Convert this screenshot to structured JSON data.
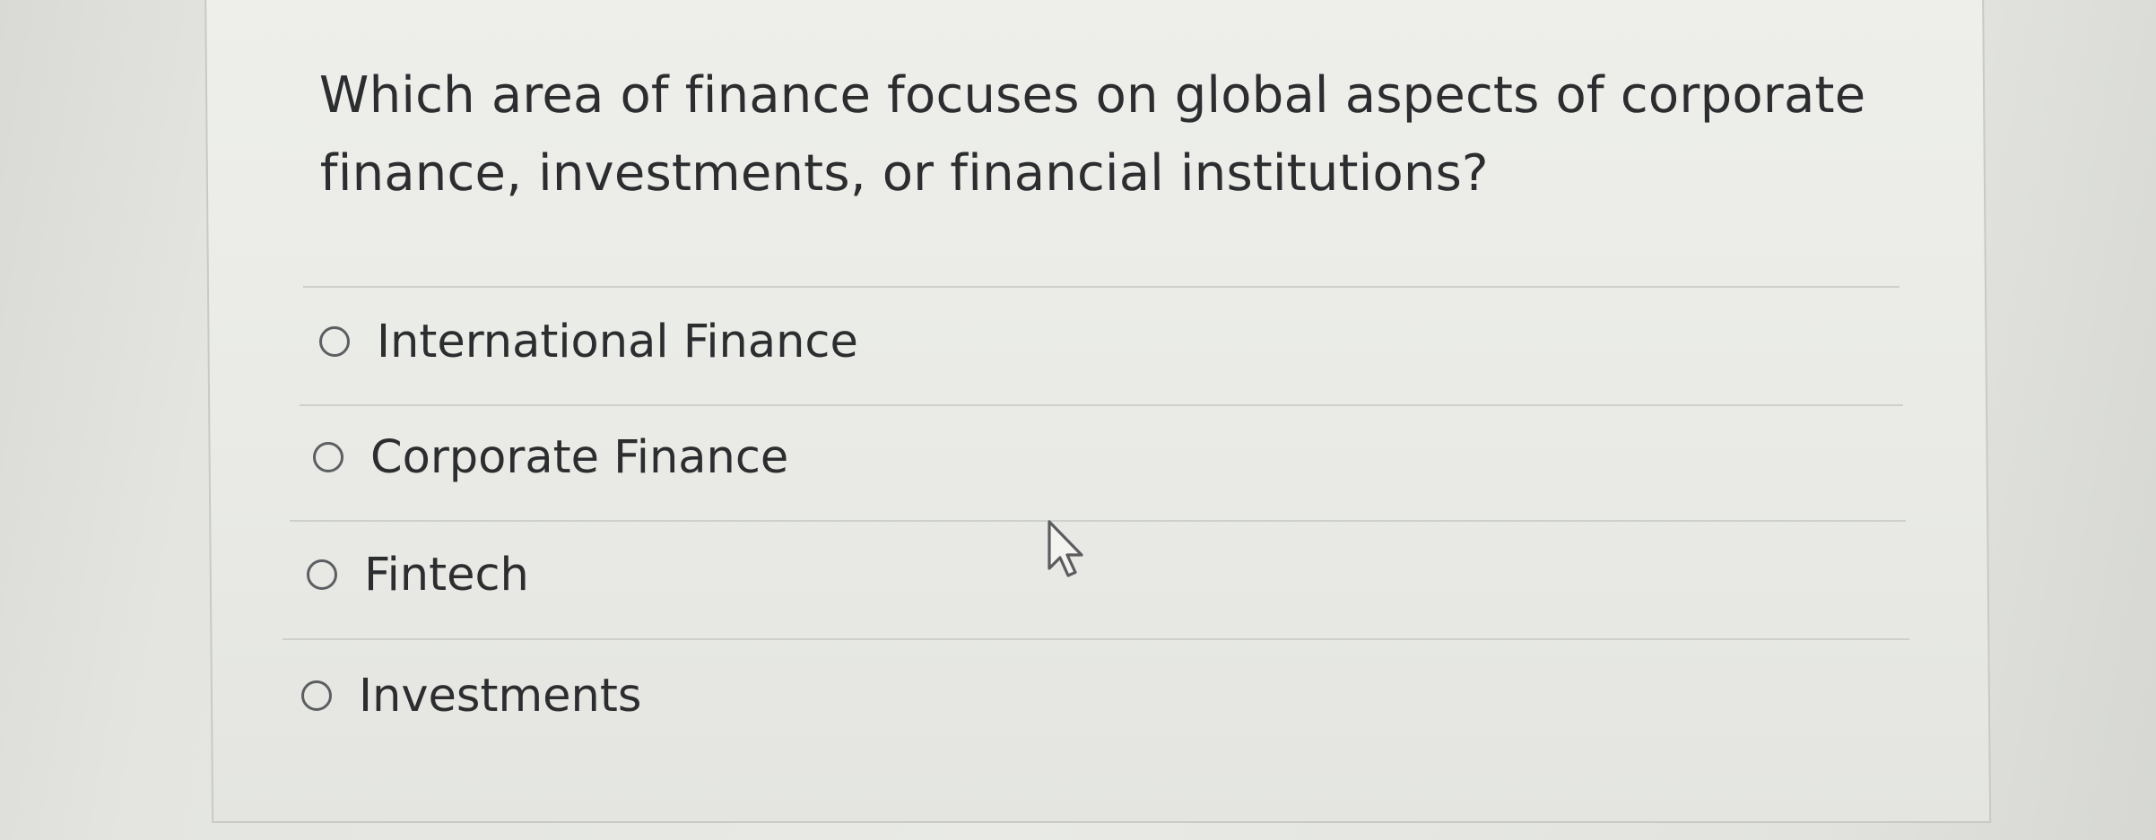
{
  "question": {
    "text": "Which area of finance focuses on global aspects of corporate finance, investments, or financial institutions?"
  },
  "options": [
    {
      "label": "International Finance",
      "selected": false
    },
    {
      "label": "Corporate Finance",
      "selected": false
    },
    {
      "label": "Fintech",
      "selected": false
    },
    {
      "label": "Investments",
      "selected": false
    }
  ],
  "cursor": {
    "icon": "arrow-pointer-icon"
  }
}
